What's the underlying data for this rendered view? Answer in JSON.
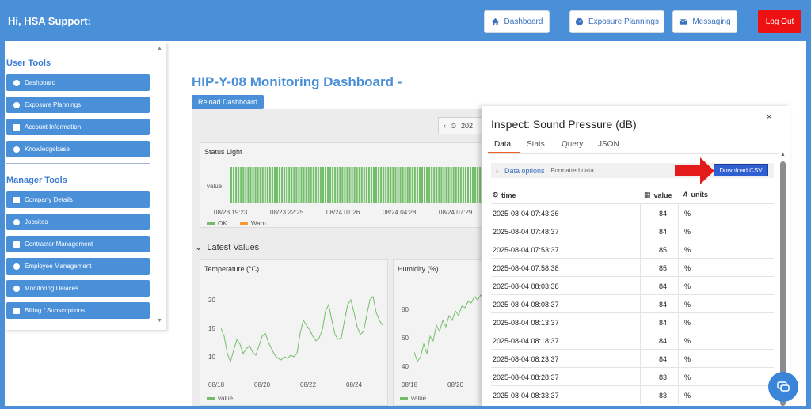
{
  "header": {
    "greeting": "Hi, HSA Support:",
    "nav": [
      {
        "label": "Dashboard",
        "icon": "home-icon"
      },
      {
        "label": "Exposure Plannings",
        "icon": "gauge-icon"
      },
      {
        "label": "Messaging",
        "icon": "envelope-icon"
      }
    ],
    "logout_label": "Log Out"
  },
  "sidebar": {
    "user_tools_title": "User Tools",
    "user_items": [
      "Dashboard",
      "Exposure Plannings",
      "Account Information",
      "Knowledgebase"
    ],
    "manager_tools_title": "Manager Tools",
    "manager_items": [
      "Company Details",
      "Jobsites",
      "Contractor Management",
      "Employee Management",
      "Monitoring Devices",
      "Billing / Subscriptions"
    ]
  },
  "dashboard": {
    "title": "HIP-Y-08 Monitoring Dashboard -",
    "reload_label": "Reload Dashboard",
    "time_picker_partial": "202",
    "status_panel": {
      "title": "Status Light",
      "y_label": "value",
      "x_ticks": [
        "08/23 19:23",
        "08/23 22:25",
        "08/24 01:26",
        "08/24 04:28",
        "08/24 07:29"
      ],
      "legend": [
        {
          "name": "OK",
          "color": "#73bf69"
        },
        {
          "name": "Warn",
          "color": "#ff9830"
        }
      ]
    },
    "latest_title": "Latest Values",
    "temperature_panel": {
      "title": "Temperature (°C)",
      "y_ticks": [
        "20",
        "15",
        "10"
      ],
      "x_ticks": [
        "08/18",
        "08/20",
        "08/22",
        "08/24"
      ],
      "legend": "value"
    },
    "humidity_panel": {
      "title": "Humidity (%)",
      "y_ticks": [
        "80",
        "60",
        "40"
      ],
      "x_ticks": [
        "08/18",
        "08/20"
      ],
      "legend": "value"
    }
  },
  "inspect": {
    "title": "Inspect: Sound Pressure (dB)",
    "close_label": "×",
    "tabs": [
      "Data",
      "Stats",
      "Query",
      "JSON"
    ],
    "data_options_label": "Data options",
    "formatted_label": "Formatted data",
    "download_label": "Download CSV",
    "columns": {
      "time": "time",
      "value": "value",
      "units": "units"
    },
    "rows": [
      {
        "time": "2025-08-04 07:43:36",
        "value": "84",
        "unit": "%"
      },
      {
        "time": "2025-08-04 07:48:37",
        "value": "84",
        "unit": "%"
      },
      {
        "time": "2025-08-04 07:53:37",
        "value": "85",
        "unit": "%"
      },
      {
        "time": "2025-08-04 07:58:38",
        "value": "85",
        "unit": "%"
      },
      {
        "time": "2025-08-04 08:03:38",
        "value": "84",
        "unit": "%"
      },
      {
        "time": "2025-08-04 08:08:37",
        "value": "84",
        "unit": "%"
      },
      {
        "time": "2025-08-04 08:13:37",
        "value": "84",
        "unit": "%"
      },
      {
        "time": "2025-08-04 08:18:37",
        "value": "84",
        "unit": "%"
      },
      {
        "time": "2025-08-04 08:23:37",
        "value": "84",
        "unit": "%"
      },
      {
        "time": "2025-08-04 08:28:37",
        "value": "83",
        "unit": "%"
      },
      {
        "time": "2025-08-04 08:33:37",
        "value": "83",
        "unit": "%"
      }
    ]
  },
  "colors": {
    "accent": "#4a90d9",
    "logout": "#ee1111",
    "ok": "#73bf69",
    "warn": "#ff9830",
    "csv": "#2f5fd0",
    "arrow": "#e31b1b"
  }
}
